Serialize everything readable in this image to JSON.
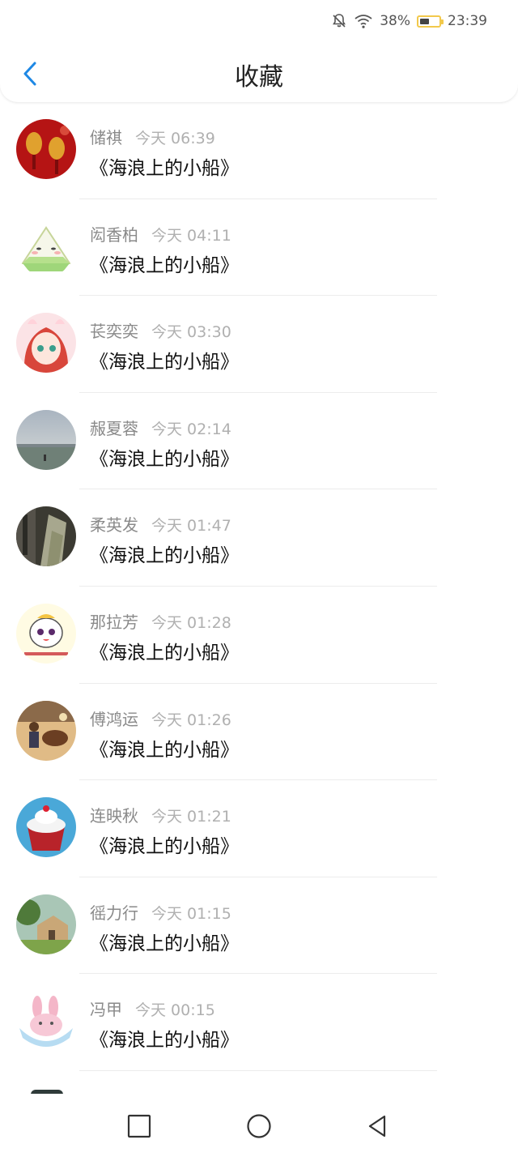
{
  "status": {
    "battery_pct": "38%",
    "time": "23:39"
  },
  "header": {
    "title": "收藏"
  },
  "items": [
    {
      "name": "储祺",
      "time": "今天 06:39",
      "title": "《海浪上的小船》"
    },
    {
      "name": "闳香柏",
      "time": "今天 04:11",
      "title": "《海浪上的小船》"
    },
    {
      "name": "苌奕奕",
      "time": "今天 03:30",
      "title": "《海浪上的小船》"
    },
    {
      "name": "赧夏蓉",
      "time": "今天 02:14",
      "title": "《海浪上的小船》"
    },
    {
      "name": "柔英发",
      "time": "今天 01:47",
      "title": "《海浪上的小船》"
    },
    {
      "name": "那拉芳",
      "time": "今天 01:28",
      "title": "《海浪上的小船》"
    },
    {
      "name": "傅鸿运",
      "time": "今天 01:26",
      "title": "《海浪上的小船》"
    },
    {
      "name": "连映秋",
      "time": "今天 01:21",
      "title": "《海浪上的小船》"
    },
    {
      "name": "徭力行",
      "time": "今天 01:15",
      "title": "《海浪上的小船》"
    },
    {
      "name": "冯甲",
      "time": "今天 00:15",
      "title": "《海浪上的小船》"
    }
  ],
  "icons": {
    "back": "chevron-left-icon",
    "nav_recent": "square-icon",
    "nav_home": "circle-icon",
    "nav_back": "triangle-back-icon"
  },
  "colors": {
    "accent": "#1e88e5",
    "battery": "#f2c94c"
  }
}
